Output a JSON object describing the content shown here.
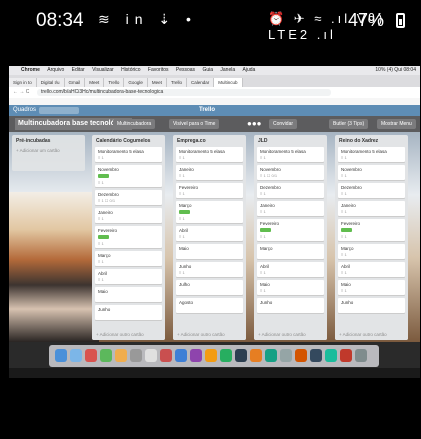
{
  "phone_status": {
    "time": "08:34",
    "left_icons": "≋ in ⇣ •",
    "right_icons": "⏰ ✈ ≈ .ıl Vo) LTE2 .ıl",
    "battery": "47%"
  },
  "mac_menubar": {
    "items": [
      "Chrome",
      "Arquivo",
      "Editar",
      "Visualizar",
      "Histórico",
      "Favoritos",
      "Pessoas",
      "Guia",
      "Janela",
      "Ajuda"
    ],
    "right": "10% (4)  Qui 08:04"
  },
  "browser": {
    "tabs": [
      "Sign in to",
      "Digital I/u",
      "Gmail",
      "Meet",
      "Trello",
      "Google",
      "Meet",
      "Trello",
      "Calendar",
      "Multincub"
    ],
    "url": "trello.com/b/aHCi3Hc/multincubadora-base-tecnologica"
  },
  "trello_header": {
    "boards_label": "Quadros",
    "logo": "Trello"
  },
  "board_bar": {
    "title": "Multincubadora base tecnológica",
    "team": "Multincubadora",
    "visibility": "Visível para o Time",
    "invite": "Convidar",
    "butler": "Butler (3 Tips)",
    "menu": "Mostrar Menu"
  },
  "lists": [
    {
      "title": "Pré-incubadas",
      "add": "+ Adicionar um cartão",
      "cards": [],
      "footer": ""
    },
    {
      "title": "Calendário Cogumelos",
      "add": "",
      "cards": [
        {
          "text": "Monitoramento 5 elasa",
          "label": false,
          "badge": "≡ 1"
        },
        {
          "text": "Novembro",
          "label": true,
          "badge": "≡ 1"
        },
        {
          "text": "Dezembro",
          "label": false,
          "badge": "≡ 1  ☐ 0/1"
        },
        {
          "text": "Janeiro",
          "label": false,
          "badge": "≡ 1"
        },
        {
          "text": "Fevereiro",
          "label": true,
          "badge": "≡ 1"
        },
        {
          "text": "Março",
          "label": false,
          "badge": "≡ 1"
        },
        {
          "text": "Abril",
          "label": false,
          "badge": "≡ 1"
        },
        {
          "text": "Maio",
          "label": false,
          "badge": ""
        },
        {
          "text": "Junho",
          "label": false,
          "badge": ""
        }
      ],
      "footer": "+ Adicionar outro cartão"
    },
    {
      "title": "Emprega.co",
      "add": "",
      "cards": [
        {
          "text": "Monitoramento 5 elasa",
          "label": false,
          "badge": "≡ 1"
        },
        {
          "text": "Janeiro",
          "label": false,
          "badge": "≡ 1"
        },
        {
          "text": "Fevereiro",
          "label": false,
          "badge": "≡ 1"
        },
        {
          "text": "Março",
          "label": true,
          "badge": "≡ 1"
        },
        {
          "text": "Abril",
          "label": false,
          "badge": "≡ 1"
        },
        {
          "text": "Maio",
          "label": false,
          "badge": ""
        },
        {
          "text": "Junho",
          "label": false,
          "badge": "≡ 1"
        },
        {
          "text": "Julho",
          "label": false,
          "badge": ""
        },
        {
          "text": "Agosto",
          "label": false,
          "badge": ""
        }
      ],
      "footer": "+ Adicionar outro cartão"
    },
    {
      "title": "JLD",
      "add": "",
      "cards": [
        {
          "text": "Monitoramento 5 elasa",
          "label": false,
          "badge": "≡ 1"
        },
        {
          "text": "Novembro",
          "label": false,
          "badge": "≡ 1  ☐ 0/1"
        },
        {
          "text": "Dezembro",
          "label": false,
          "badge": "≡ 1"
        },
        {
          "text": "Janeiro",
          "label": false,
          "badge": "≡ 1"
        },
        {
          "text": "Fevereiro",
          "label": true,
          "badge": "≡ 1"
        },
        {
          "text": "Março",
          "label": false,
          "badge": ""
        },
        {
          "text": "Abril",
          "label": false,
          "badge": "≡ 1"
        },
        {
          "text": "Maio",
          "label": false,
          "badge": "≡ 1"
        },
        {
          "text": "Junho",
          "label": false,
          "badge": ""
        }
      ],
      "footer": "+ Adicionar outro cartão"
    },
    {
      "title": "Reino do Xadrez",
      "add": "",
      "cards": [
        {
          "text": "Monitoramento 5 elasa",
          "label": false,
          "badge": "≡ 1"
        },
        {
          "text": "Novembro",
          "label": false,
          "badge": "≡ 1"
        },
        {
          "text": "Dezembro",
          "label": false,
          "badge": "≡ 1"
        },
        {
          "text": "Janeiro",
          "label": false,
          "badge": "≡ 1"
        },
        {
          "text": "Fevereiro",
          "label": true,
          "badge": "≡ 1"
        },
        {
          "text": "Março",
          "label": false,
          "badge": "≡ 1"
        },
        {
          "text": "Abril",
          "label": false,
          "badge": "≡ 1"
        },
        {
          "text": "Maio",
          "label": false,
          "badge": "≡ 1"
        },
        {
          "text": "Junho",
          "label": false,
          "badge": ""
        }
      ],
      "footer": "+ Adicionar outro cartão"
    }
  ],
  "colors": {
    "card_label": "#61bd4f",
    "trello_header": "#5e8db5",
    "list_bg": "#e2e4e6"
  }
}
